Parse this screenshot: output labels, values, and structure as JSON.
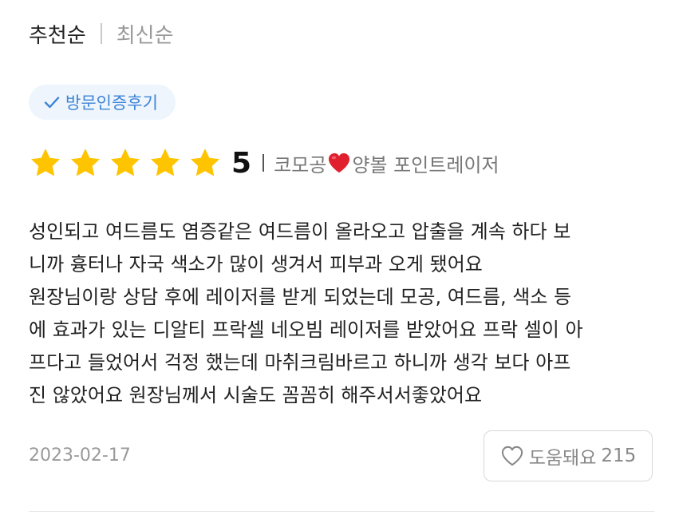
{
  "sort": {
    "recommended_label": "추천순",
    "latest_label": "최신순"
  },
  "badge": {
    "label": "방문인증후기",
    "icon": "check-icon",
    "color": "#3d84d6"
  },
  "review": {
    "rating": 5,
    "rating_label": "5",
    "star_icon": "star-icon",
    "star_color": "#ffc400",
    "treatment": {
      "before": "코모공",
      "emoji": "red-heart-icon",
      "after": "양볼 포인트레이저"
    },
    "body_lines": [
      "성인되고 여드름도 염증같은 여드름이 올라오고 압출을 계속 하다 보",
      "니까 흉터나 자국 색소가 많이 생겨서 피부과 오게 됐어요",
      "원장님이랑 상담 후에 레이저를 받게 되었는데 모공, 여드름, 색소 등",
      "에 효과가 있는 디알티 프락셀 네오빔 레이저를 받았어요 프락 셀이 아",
      "프다고 들었어서 걱정 했는데 마취크림바르고 하니까 생각 보다 아프",
      "진 않았어요 원장님께서 시술도 꼼꼼히 해주서서좋았어요"
    ],
    "date": "2023-02-17",
    "helpful": {
      "label": "도움돼요",
      "count": "215",
      "icon": "heart-outline-icon"
    }
  }
}
